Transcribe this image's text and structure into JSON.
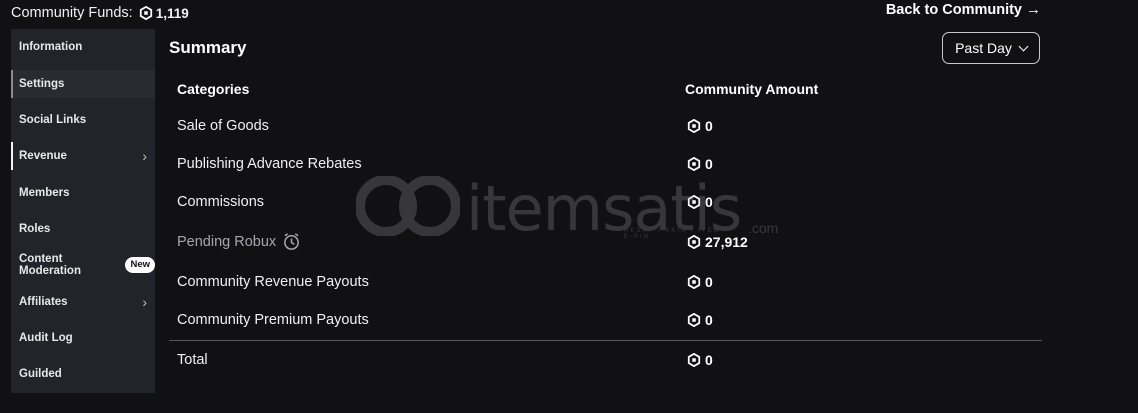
{
  "header": {
    "funds_label": "Community Funds:",
    "funds_value": "1,119",
    "back_link": "Back to Community"
  },
  "sidebar": {
    "items": [
      {
        "label": "Information"
      },
      {
        "label": "Settings"
      },
      {
        "label": "Social Links"
      },
      {
        "label": "Revenue"
      },
      {
        "label": "Members"
      },
      {
        "label": "Roles"
      },
      {
        "label": "Content Moderation",
        "badge": "New"
      },
      {
        "label": "Affiliates"
      },
      {
        "label": "Audit Log"
      },
      {
        "label": "Guilded"
      }
    ]
  },
  "summary": {
    "title": "Summary",
    "period": "Past Day",
    "col_categories": "Categories",
    "col_amount": "Community Amount",
    "rows": [
      {
        "label": "Sale of Goods",
        "amount": "0"
      },
      {
        "label": "Publishing Advance Rebates",
        "amount": "0"
      },
      {
        "label": "Commissions",
        "amount": "0"
      },
      {
        "label": "Pending Robux",
        "amount": "27,912"
      },
      {
        "label": "Community Revenue Payouts",
        "amount": "0"
      },
      {
        "label": "Community Premium Payouts",
        "amount": "0"
      }
    ],
    "total_label": "Total",
    "total_amount": "0"
  },
  "watermark": {
    "brand": "itemsatis",
    "tagline": "HESAP / SKIN / İTEM / E-PIN",
    "suffix": ".com"
  },
  "icons": {
    "currency": "robux-icon",
    "pending": "clock-icon",
    "submenu": "chevron-right-icon",
    "back": "arrow-right-icon",
    "dropdown": "chevron-down-icon"
  }
}
